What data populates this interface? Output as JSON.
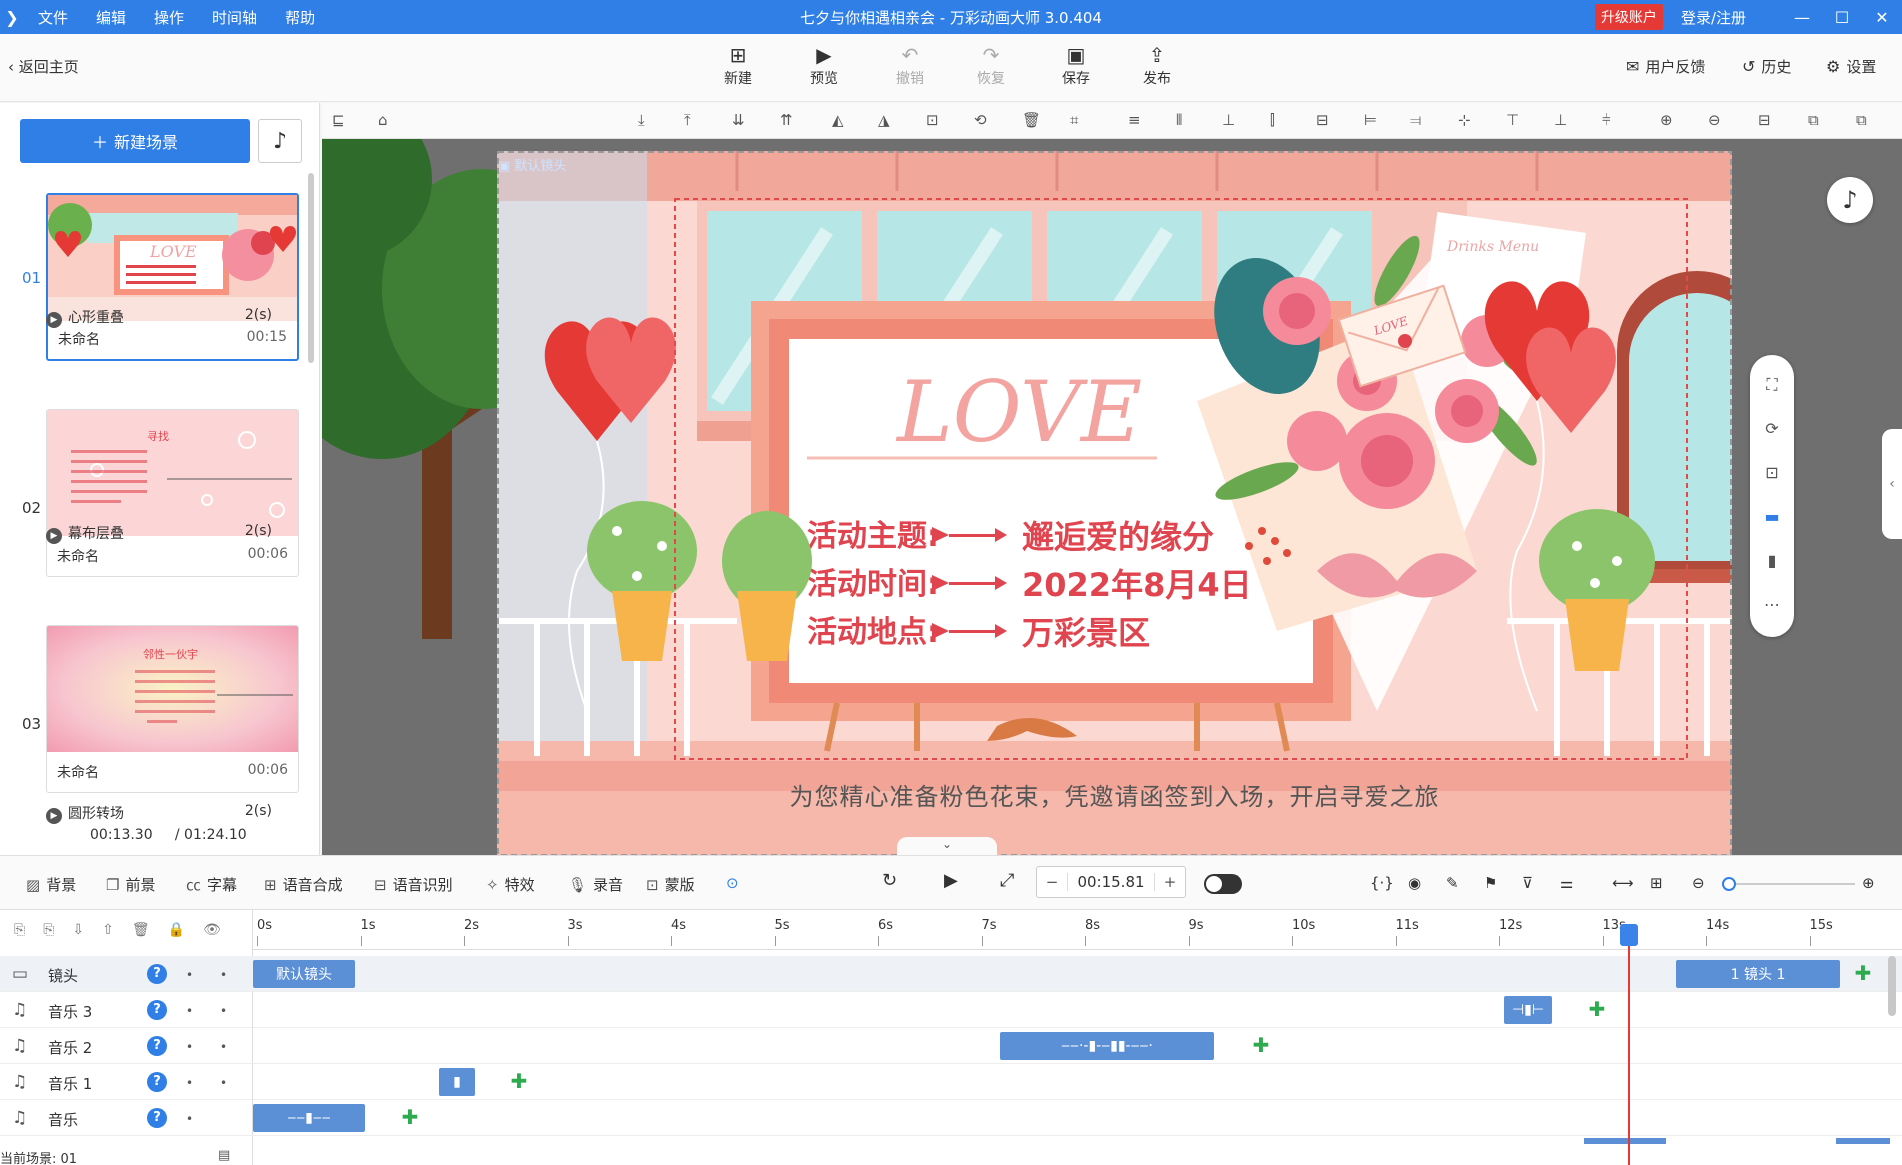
{
  "titlebar": {
    "menu": [
      "文件",
      "编辑",
      "操作",
      "时间轴",
      "帮助"
    ],
    "title": "七夕与你相遇相亲会 - 万彩动画大师 3.0.404",
    "upgrade": "升级账户",
    "login": "登录/注册",
    "minimize": "—",
    "maximize": "☐",
    "close": "✕"
  },
  "toolbar": {
    "back": "返回主页",
    "new": "新建",
    "preview": "预览",
    "undo": "撤销",
    "redo": "恢复",
    "save": "保存",
    "publish": "发布",
    "feedback": "用户反馈",
    "history": "历史",
    "settings": "设置"
  },
  "left_panel": {
    "new_scene": "新建场景",
    "scenes": [
      {
        "num": "01",
        "name": "未命名",
        "duration": "00:15",
        "transition": "心形重叠",
        "trans_dur": "2(s)"
      },
      {
        "num": "02",
        "name": "未命名",
        "duration": "00:06",
        "transition": "幕布层叠",
        "trans_dur": "2(s)"
      },
      {
        "num": "03",
        "name": "未命名",
        "duration": "00:06",
        "transition": "圆形转场",
        "trans_dur": "2(s)"
      }
    ],
    "current_time": "00:13.30",
    "total_time": "/ 01:24.10",
    "thumb2_title": "寻找",
    "thumb3_title": "邻性一伙宇"
  },
  "canvas": {
    "camera_label": "默认镜头",
    "love": "LOVE",
    "rows": [
      {
        "label": "活动主题:",
        "value": "邂逅爱的缘分"
      },
      {
        "label": "活动时间:",
        "value": "2022年8月4日"
      },
      {
        "label": "活动地点:",
        "value": "万彩景区"
      }
    ],
    "subtitle": "为您精心准备粉色花束，凭邀请函签到入场，开启寻爱之旅",
    "card_text": "Drinks Menu",
    "letter_text": "LOVE"
  },
  "bottom_toolbar": {
    "background": "背景",
    "foreground": "前景",
    "caption": "字幕",
    "tts": "语音合成",
    "asr": "语音识别",
    "effects": "特效",
    "record": "录音",
    "mask": "蒙版",
    "minus": "−",
    "time": "00:15.81",
    "plus": "+"
  },
  "timeline": {
    "ticks": [
      "0s",
      "1s",
      "2s",
      "3s",
      "4s",
      "5s",
      "6s",
      "7s",
      "8s",
      "9s",
      "10s",
      "11s",
      "12s",
      "13s",
      "14s",
      "15s"
    ],
    "tracks": [
      {
        "name": "镜头"
      },
      {
        "name": "音乐 3"
      },
      {
        "name": "音乐 2"
      },
      {
        "name": "音乐 1"
      },
      {
        "name": "音乐"
      }
    ],
    "default_camera_clip": "默认镜头",
    "camera1_clip": "1 镜头 1",
    "current_scene": "当前场景: 01"
  },
  "colors": {
    "accent": "#2f7fe6",
    "upgrade": "#e53935",
    "stage_pink": "#fbd9d2",
    "love_red": "#e0454f"
  }
}
